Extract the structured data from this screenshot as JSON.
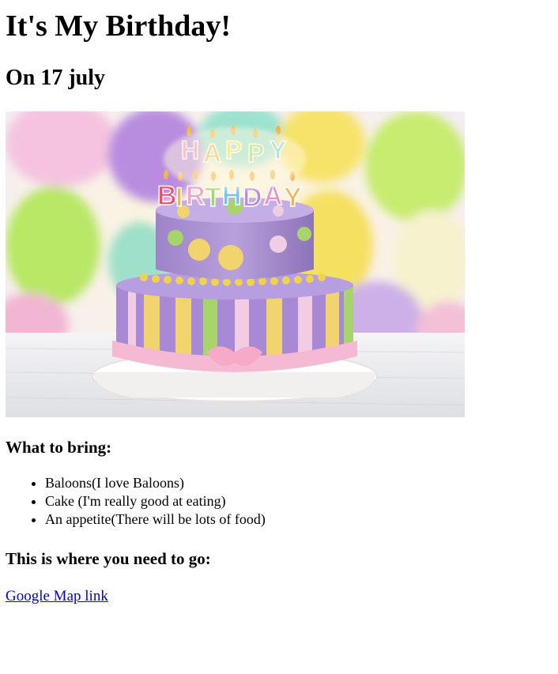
{
  "page": {
    "title": "It's My Birthday!",
    "date_heading": "On 17 july",
    "image": {
      "subject": "birthday-cake-photo",
      "candle_text_top": "HAPPY",
      "candle_text_bottom": "BIRTHDAY"
    },
    "bring_heading": "What to bring:",
    "bring_items": [
      "Baloons(I love Baloons)",
      "Cake (I'm really good at eating)",
      "An appetite(There will be lots of food)"
    ],
    "directions_heading": "This is where you need to go:",
    "map_link_label": "Google Map link"
  },
  "colors": {
    "link": "#0000ee",
    "footer_bar": "#1c252c"
  }
}
